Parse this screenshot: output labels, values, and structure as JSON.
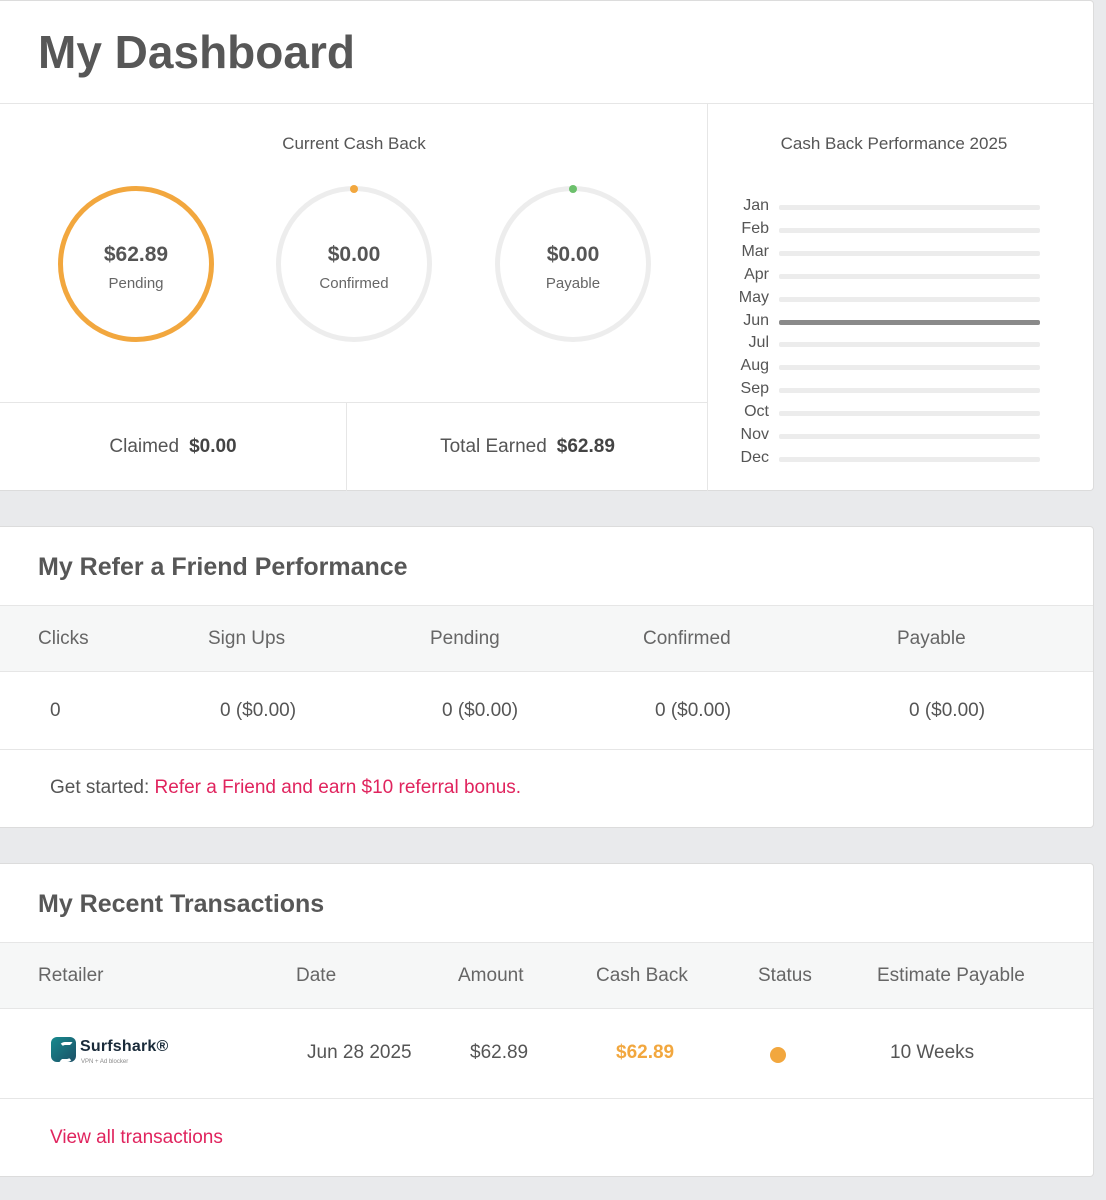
{
  "dashboard": {
    "title": "My Dashboard",
    "current_cash_back": {
      "heading": "Current Cash Back",
      "rings": [
        {
          "amount": "$62.89",
          "label": "Pending",
          "fraction": 1.0,
          "color": "#f2a73e"
        },
        {
          "amount": "$0.00",
          "label": "Confirmed",
          "fraction": 0.0,
          "color": "#f2a73e"
        },
        {
          "amount": "$0.00",
          "label": "Payable",
          "fraction": 0.0,
          "color": "#6cc06c"
        }
      ],
      "claimed_label": "Claimed",
      "claimed_value": "$0.00",
      "total_label": "Total Earned",
      "total_value": "$62.89"
    },
    "performance": {
      "heading": "Cash Back Performance 2025",
      "months": [
        {
          "month": "Jan",
          "value": 0
        },
        {
          "month": "Feb",
          "value": 0
        },
        {
          "month": "Mar",
          "value": 0
        },
        {
          "month": "Apr",
          "value": 0
        },
        {
          "month": "May",
          "value": 0
        },
        {
          "month": "Jun",
          "value": 1
        },
        {
          "month": "Jul",
          "value": 0
        },
        {
          "month": "Aug",
          "value": 0
        },
        {
          "month": "Sep",
          "value": 0
        },
        {
          "month": "Oct",
          "value": 0
        },
        {
          "month": "Nov",
          "value": 0
        },
        {
          "month": "Dec",
          "value": 0
        }
      ]
    }
  },
  "refer": {
    "title": "My Refer a Friend Performance",
    "columns": [
      "Clicks",
      "Sign Ups",
      "Pending",
      "Confirmed",
      "Payable"
    ],
    "values": [
      "0",
      "0 ($0.00)",
      "0 ($0.00)",
      "0 ($0.00)",
      "0 ($0.00)"
    ],
    "footer_prefix": "Get started: ",
    "footer_link": "Refer a Friend and earn $10 referral bonus."
  },
  "transactions": {
    "title": "My Recent Transactions",
    "columns": [
      "Retailer",
      "Date",
      "Amount",
      "Cash Back",
      "Status",
      "Estimate Payable"
    ],
    "rows": [
      {
        "retailer": "Surfshark",
        "retailer_sub": "VPN + Ad blocker",
        "date": "Jun 28 2025",
        "amount": "$62.89",
        "cash_back": "$62.89",
        "status": "pending",
        "status_color": "#f2a73e",
        "estimate": "10 Weeks"
      }
    ],
    "view_all": "View all transactions"
  }
}
